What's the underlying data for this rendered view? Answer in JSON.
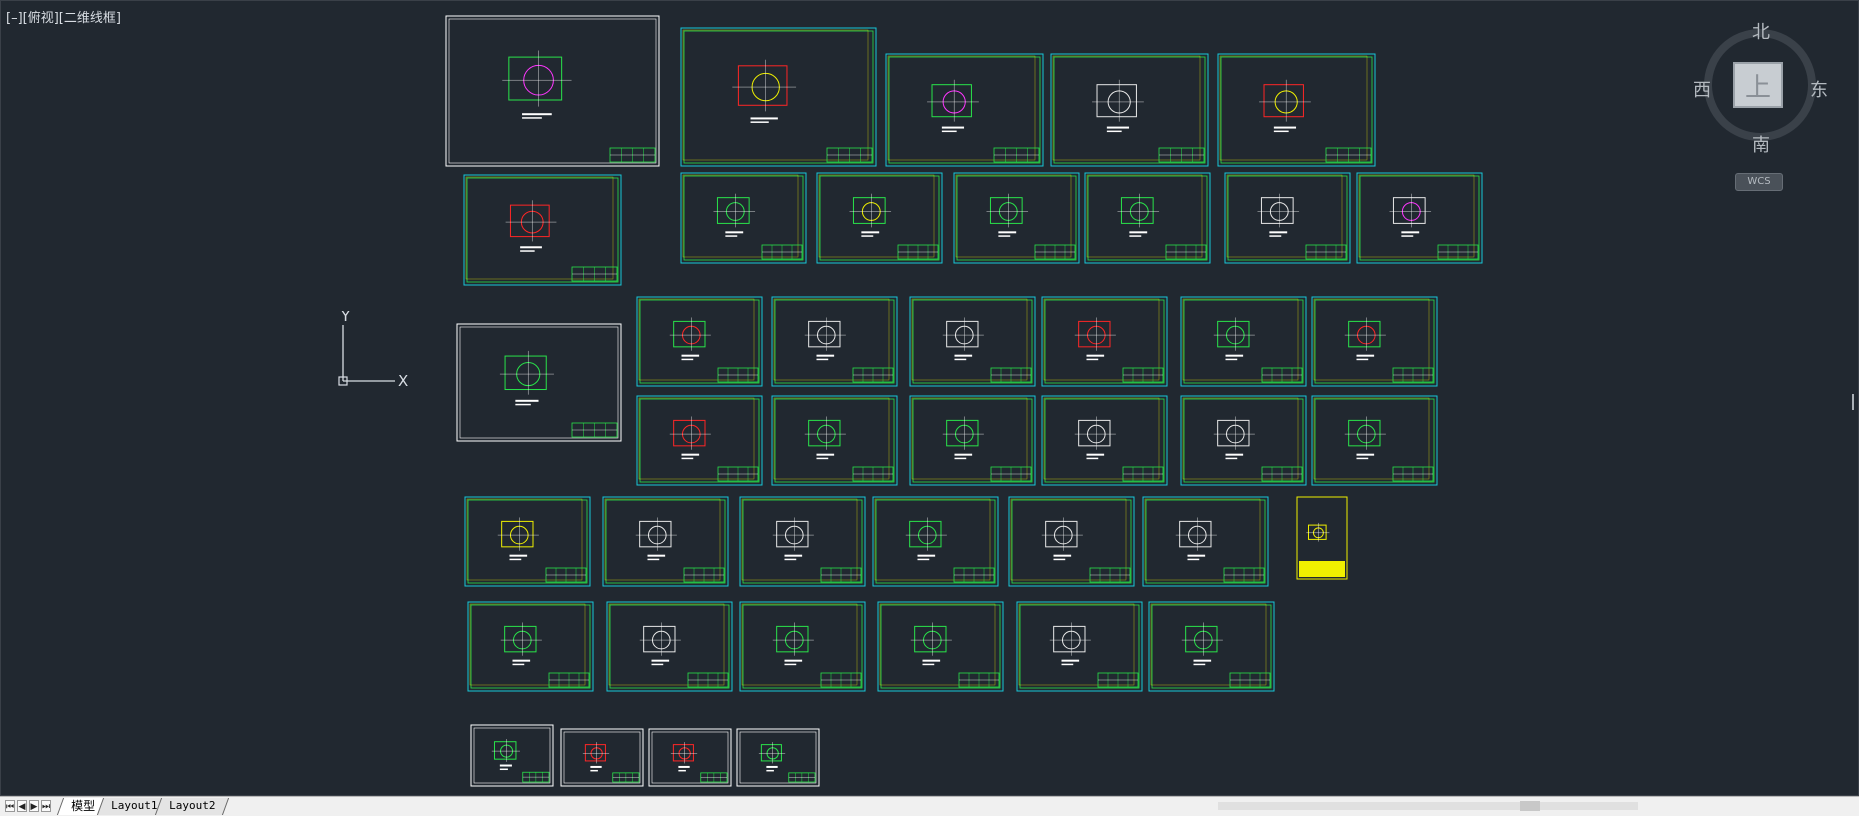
{
  "viewport": {
    "view_controls": "[–][俯视][二维线框]",
    "ucs": {
      "x_label": "X",
      "y_label": "Y"
    },
    "viewcube": {
      "top_face": "上",
      "north": "北",
      "south": "南",
      "east": "东",
      "west": "西",
      "wcs_label": "WCS"
    }
  },
  "tabs": {
    "model": "模型",
    "layout1": "Layout1",
    "layout2": "Layout2"
  },
  "colors": {
    "background": "#212830",
    "sheet_outer": "#ffffff",
    "sheet_inner_green": "#29e34a",
    "sheet_cyan": "#18c8d8",
    "part_red": "#ff2626",
    "part_yellow": "#f0f000",
    "part_magenta": "#ff36ff"
  },
  "icons": [
    "ucs-axes-icon",
    "viewcube-icon",
    "first-tab-icon",
    "prev-tab-icon",
    "next-tab-icon",
    "last-tab-icon"
  ]
}
